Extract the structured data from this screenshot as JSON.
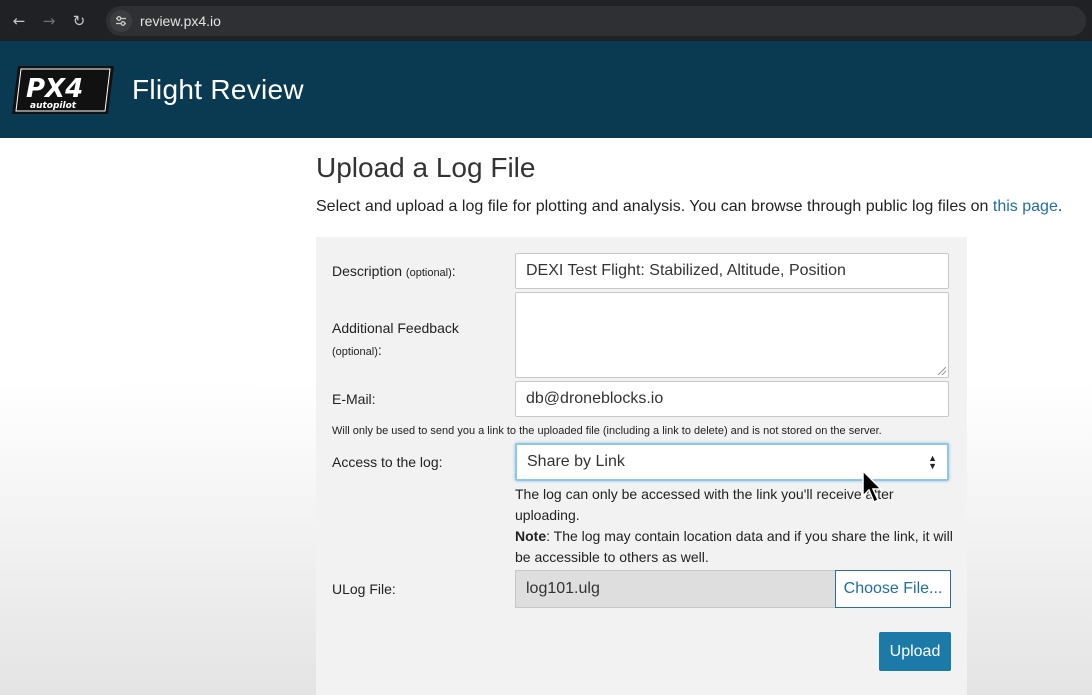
{
  "browser": {
    "back_icon": "arrow-left-icon",
    "forward_icon": "arrow-right-icon",
    "reload_icon": "reload-icon",
    "site_settings_icon": "tune-icon",
    "url": "review.px4.io"
  },
  "header": {
    "logo_text": "PX4 autopilot",
    "title": "Flight Review",
    "background_color": "#0a3a52"
  },
  "page": {
    "title": "Upload a Log File",
    "intro_text": "Select and upload a log file for plotting and analysis. You can browse through public log files on ",
    "intro_link": "this page",
    "intro_end": "."
  },
  "form": {
    "description": {
      "label": "Description",
      "optional": "(optional)",
      "colon": ":",
      "value": "DEXI Test Flight: Stabilized, Altitude, Position"
    },
    "feedback": {
      "label": "Additional Feedback",
      "optional": "(optional)",
      "colon": ":",
      "value": ""
    },
    "email": {
      "label": "E-Mail:",
      "value": "db@droneblocks.io",
      "note": "Will only be used to send you a link to the uploaded file (including a link to delete) and is not stored on the server."
    },
    "access": {
      "label": "Access to the log:",
      "selected": "Share by Link",
      "help_text": "The log can only be accessed with the link you'll receive after uploading.",
      "note_label": "Note",
      "note_text": ": The log may contain location data and if you share the link, it will be accessible to others as well."
    },
    "ulog": {
      "label": "ULog File:",
      "file_name": "log101.ulg",
      "choose_label": "Choose File..."
    },
    "upload_label": "Upload",
    "accent_color": "#1b7aa7"
  }
}
